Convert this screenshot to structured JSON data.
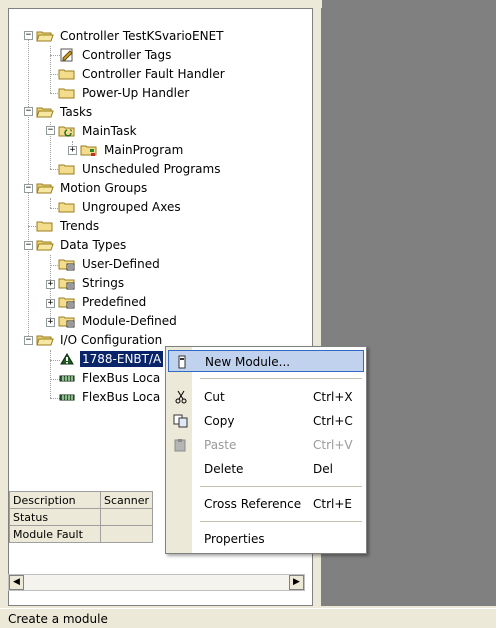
{
  "tree": {
    "nodes": [
      {
        "label": "Controller TestKSvarioENET",
        "icon": "folder-open-icon",
        "expander": "minus"
      },
      {
        "label": "Controller Tags",
        "icon": "tag-document-icon"
      },
      {
        "label": "Controller Fault Handler",
        "icon": "folder-icon"
      },
      {
        "label": "Power-Up Handler",
        "icon": "folder-icon"
      },
      {
        "label": "Tasks",
        "icon": "folder-open-icon",
        "expander": "minus"
      },
      {
        "label": "MainTask",
        "icon": "task-icon",
        "expander": "minus"
      },
      {
        "label": "MainProgram",
        "icon": "program-icon",
        "expander": "plus"
      },
      {
        "label": "Unscheduled Programs",
        "icon": "folder-icon"
      },
      {
        "label": "Motion Groups",
        "icon": "folder-open-icon",
        "expander": "minus"
      },
      {
        "label": "Ungrouped Axes",
        "icon": "folder-icon"
      },
      {
        "label": "Trends",
        "icon": "folder-icon"
      },
      {
        "label": "Data Types",
        "icon": "folder-open-icon",
        "expander": "minus"
      },
      {
        "label": "User-Defined",
        "icon": "data-type-folder-icon"
      },
      {
        "label": "Strings",
        "icon": "data-type-folder-icon",
        "expander": "plus"
      },
      {
        "label": "Predefined",
        "icon": "data-type-folder-icon",
        "expander": "plus"
      },
      {
        "label": "Module-Defined",
        "icon": "data-type-folder-icon",
        "expander": "plus"
      },
      {
        "label": "I/O Configuration",
        "icon": "folder-open-icon",
        "expander": "minus"
      },
      {
        "label": "1788-ENBT/A",
        "icon": "network-module-icon",
        "selected": true
      },
      {
        "label": "FlexBus Loca",
        "icon": "flexbus-icon"
      },
      {
        "label": "FlexBus Loca",
        "icon": "flexbus-icon"
      }
    ]
  },
  "properties": {
    "rows": [
      {
        "key": "Description",
        "value": "Scanner"
      },
      {
        "key": "Status",
        "value": ""
      },
      {
        "key": "Module Fault",
        "value": ""
      }
    ]
  },
  "context_menu": {
    "items": [
      {
        "label": "New Module...",
        "shortcut": "",
        "icon": "new-module-icon",
        "highlighted": true
      },
      {
        "label": "Cut",
        "shortcut": "Ctrl+X",
        "icon": "scissors-icon"
      },
      {
        "label": "Copy",
        "shortcut": "Ctrl+C",
        "icon": "copy-icon"
      },
      {
        "label": "Paste",
        "shortcut": "Ctrl+V",
        "icon": "paste-icon",
        "disabled": true
      },
      {
        "label": "Delete",
        "shortcut": "Del",
        "icon": ""
      },
      {
        "label": "Cross Reference",
        "shortcut": "Ctrl+E",
        "icon": ""
      },
      {
        "label": "Properties",
        "shortcut": "",
        "icon": ""
      }
    ]
  },
  "status_bar": {
    "text": "Create a module"
  },
  "colors": {
    "selection": "#0a246a",
    "menu_highlight": "#c1d2ee",
    "right_pane": "#808080"
  }
}
